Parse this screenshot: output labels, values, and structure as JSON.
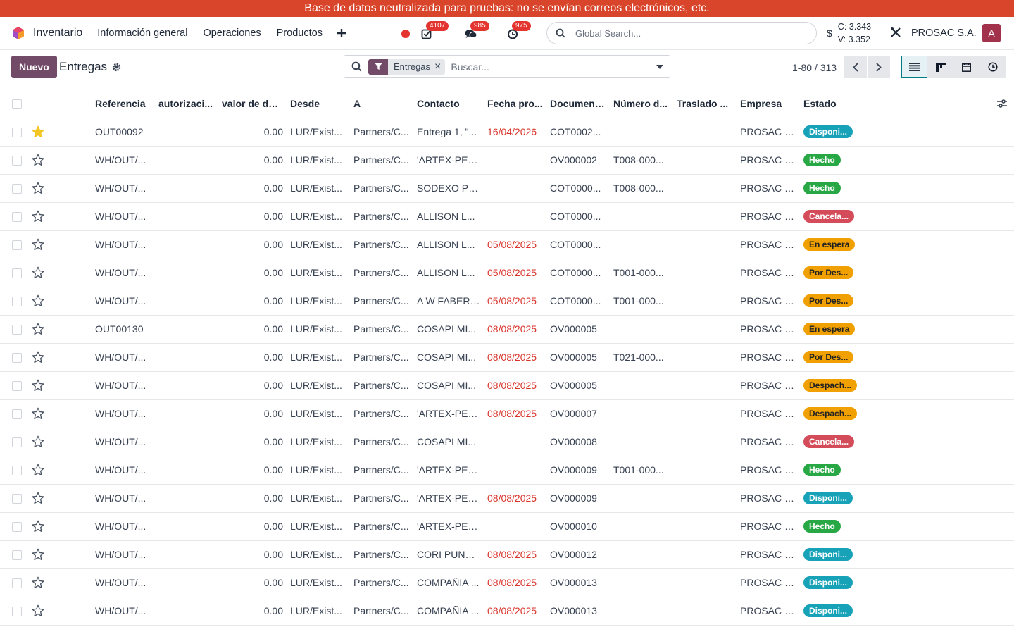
{
  "banner": "Base de datos neutralizada para pruebas: no se envían correos electrónicos, etc.",
  "navbar": {
    "app_name": "Inventario",
    "menu": [
      "Información general",
      "Operaciones",
      "Productos"
    ],
    "plus_icon": "plus-icon",
    "activity_count": "4107",
    "messages_count": "985",
    "timer_count": "975",
    "global_search_placeholder": "Global Search...",
    "currency_symbol": "$",
    "c_rate": "C: 3.343",
    "v_rate": "V: 3.352",
    "company": "PROSAC S.A.",
    "avatar_letter": "A",
    "avatar_color": "#a2324b"
  },
  "control": {
    "new_label": "Nuevo",
    "breadcrumb": "Entregas",
    "facet": "Entregas",
    "search_placeholder": "Buscar...",
    "pager": "1-80 / 313"
  },
  "colors": {
    "brand": "#714b67",
    "banner": "#d9452b",
    "late": "#d9342b"
  },
  "table": {
    "headers": [
      "Referencia",
      "autorizaci...",
      "valor de des...",
      "Desde",
      "A",
      "Contacto",
      "Fecha pro...",
      "Document...",
      "Número d...",
      "Traslado ...",
      "Empresa",
      "Estado"
    ],
    "rows": [
      {
        "starred": true,
        "ref": "OUT00092",
        "auth": "",
        "value": "0.00",
        "from": "LUR/Exist...",
        "to": "Partners/C...",
        "contact": "Entrega 1, \"...",
        "date": "16/04/2026",
        "late": true,
        "doc": "COT0002...",
        "num": "",
        "transfer": "",
        "company": "PROSAC S...",
        "status": "Disponi...",
        "status_type": "blue"
      },
      {
        "starred": false,
        "ref": "WH/OUT/...",
        "auth": "",
        "value": "0.00",
        "from": "LUR/Exist...",
        "to": "Partners/C...",
        "contact": "'ARTEX-PER...",
        "date": "",
        "late": false,
        "doc": "OV000002",
        "num": "T008-000...",
        "transfer": "",
        "company": "PROSAC S...",
        "status": "Hecho",
        "status_type": "green"
      },
      {
        "starred": false,
        "ref": "WH/OUT/...",
        "auth": "",
        "value": "0.00",
        "from": "LUR/Exist...",
        "to": "Partners/C...",
        "contact": "SODEXO PE...",
        "date": "",
        "late": false,
        "doc": "COT0000...",
        "num": "T008-000...",
        "transfer": "",
        "company": "PROSAC S...",
        "status": "Hecho",
        "status_type": "green"
      },
      {
        "starred": false,
        "ref": "WH/OUT/...",
        "auth": "",
        "value": "0.00",
        "from": "LUR/Exist...",
        "to": "Partners/C...",
        "contact": "ALLISON L...",
        "date": "",
        "late": false,
        "doc": "COT0000...",
        "num": "",
        "transfer": "",
        "company": "PROSAC S...",
        "status": "Cancela...",
        "status_type": "red"
      },
      {
        "starred": false,
        "ref": "WH/OUT/...",
        "auth": "",
        "value": "0.00",
        "from": "LUR/Exist...",
        "to": "Partners/C...",
        "contact": "ALLISON L...",
        "date": "05/08/2025",
        "late": true,
        "doc": "COT0000...",
        "num": "",
        "transfer": "",
        "company": "PROSAC S...",
        "status": "En espera",
        "status_type": "orange"
      },
      {
        "starred": false,
        "ref": "WH/OUT/...",
        "auth": "",
        "value": "0.00",
        "from": "LUR/Exist...",
        "to": "Partners/C...",
        "contact": "ALLISON L...",
        "date": "05/08/2025",
        "late": true,
        "doc": "COT0000...",
        "num": "T001-000...",
        "transfer": "",
        "company": "PROSAC S...",
        "status": "Por Des...",
        "status_type": "orange"
      },
      {
        "starred": false,
        "ref": "WH/OUT/...",
        "auth": "",
        "value": "0.00",
        "from": "LUR/Exist...",
        "to": "Partners/C...",
        "contact": "A W FABER ...",
        "date": "05/08/2025",
        "late": true,
        "doc": "COT0000...",
        "num": "T001-000...",
        "transfer": "",
        "company": "PROSAC S...",
        "status": "Por Des...",
        "status_type": "orange"
      },
      {
        "starred": false,
        "ref": "OUT00130",
        "auth": "",
        "value": "0.00",
        "from": "LUR/Exist...",
        "to": "Partners/C...",
        "contact": "COSAPI MI...",
        "date": "08/08/2025",
        "late": true,
        "doc": "OV000005",
        "num": "",
        "transfer": "",
        "company": "PROSAC S...",
        "status": "En espera",
        "status_type": "orange"
      },
      {
        "starred": false,
        "ref": "WH/OUT/...",
        "auth": "",
        "value": "0.00",
        "from": "LUR/Exist...",
        "to": "Partners/C...",
        "contact": "COSAPI MI...",
        "date": "08/08/2025",
        "late": true,
        "doc": "OV000005",
        "num": "T021-000...",
        "transfer": "",
        "company": "PROSAC S...",
        "status": "Por Des...",
        "status_type": "orange"
      },
      {
        "starred": false,
        "ref": "WH/OUT/...",
        "auth": "",
        "value": "0.00",
        "from": "LUR/Exist...",
        "to": "Partners/C...",
        "contact": "COSAPI MI...",
        "date": "08/08/2025",
        "late": true,
        "doc": "OV000005",
        "num": "",
        "transfer": "",
        "company": "PROSAC S...",
        "status": "Despach...",
        "status_type": "orange"
      },
      {
        "starred": false,
        "ref": "WH/OUT/...",
        "auth": "",
        "value": "0.00",
        "from": "LUR/Exist...",
        "to": "Partners/C...",
        "contact": "'ARTEX-PER...",
        "date": "08/08/2025",
        "late": true,
        "doc": "OV000007",
        "num": "",
        "transfer": "",
        "company": "PROSAC S...",
        "status": "Despach...",
        "status_type": "orange"
      },
      {
        "starred": false,
        "ref": "WH/OUT/...",
        "auth": "",
        "value": "0.00",
        "from": "LUR/Exist...",
        "to": "Partners/C...",
        "contact": "COSAPI MI...",
        "date": "",
        "late": false,
        "doc": "OV000008",
        "num": "",
        "transfer": "",
        "company": "PROSAC S...",
        "status": "Cancela...",
        "status_type": "red"
      },
      {
        "starred": false,
        "ref": "WH/OUT/...",
        "auth": "",
        "value": "0.00",
        "from": "LUR/Exist...",
        "to": "Partners/C...",
        "contact": "'ARTEX-PER...",
        "date": "",
        "late": false,
        "doc": "OV000009",
        "num": "T001-000...",
        "transfer": "",
        "company": "PROSAC S...",
        "status": "Hecho",
        "status_type": "green"
      },
      {
        "starred": false,
        "ref": "WH/OUT/...",
        "auth": "",
        "value": "0.00",
        "from": "LUR/Exist...",
        "to": "Partners/C...",
        "contact": "'ARTEX-PER...",
        "date": "08/08/2025",
        "late": true,
        "doc": "OV000009",
        "num": "",
        "transfer": "",
        "company": "PROSAC S...",
        "status": "Disponi...",
        "status_type": "blue"
      },
      {
        "starred": false,
        "ref": "WH/OUT/...",
        "auth": "",
        "value": "0.00",
        "from": "LUR/Exist...",
        "to": "Partners/C...",
        "contact": "'ARTEX-PER...",
        "date": "",
        "late": false,
        "doc": "OV000010",
        "num": "",
        "transfer": "",
        "company": "PROSAC S...",
        "status": "Hecho",
        "status_type": "green"
      },
      {
        "starred": false,
        "ref": "WH/OUT/...",
        "auth": "",
        "value": "0.00",
        "from": "LUR/Exist...",
        "to": "Partners/C...",
        "contact": "CORI PUNO...",
        "date": "08/08/2025",
        "late": true,
        "doc": "OV000012",
        "num": "",
        "transfer": "",
        "company": "PROSAC S...",
        "status": "Disponi...",
        "status_type": "blue"
      },
      {
        "starred": false,
        "ref": "WH/OUT/...",
        "auth": "",
        "value": "0.00",
        "from": "LUR/Exist...",
        "to": "Partners/C...",
        "contact": "COMPAÑIA ...",
        "date": "08/08/2025",
        "late": true,
        "doc": "OV000013",
        "num": "",
        "transfer": "",
        "company": "PROSAC S...",
        "status": "Disponi...",
        "status_type": "blue"
      },
      {
        "starred": false,
        "ref": "WH/OUT/...",
        "auth": "",
        "value": "0.00",
        "from": "LUR/Exist...",
        "to": "Partners/C...",
        "contact": "COMPAÑIA ...",
        "date": "08/08/2025",
        "late": true,
        "doc": "OV000013",
        "num": "",
        "transfer": "",
        "company": "PROSAC S...",
        "status": "Disponi...",
        "status_type": "blue"
      }
    ]
  }
}
